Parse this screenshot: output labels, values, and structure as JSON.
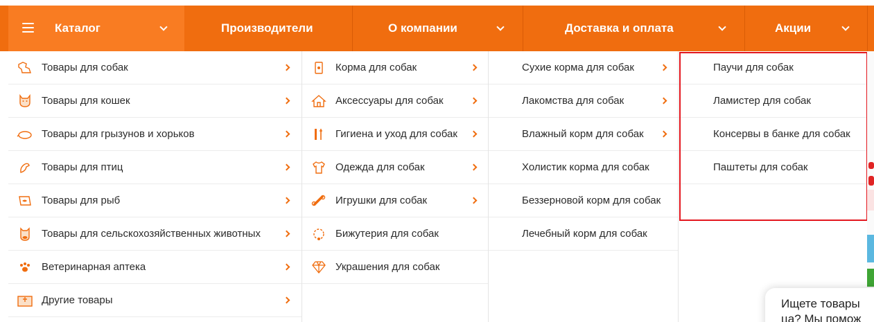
{
  "nav": {
    "catalog": "Каталог",
    "manufacturers": "Производители",
    "about": "О компании",
    "delivery": "Доставка и оплата",
    "sales": "Акции"
  },
  "colors": {
    "accent": "#f06d0f",
    "accent_light": "#f97c22",
    "highlight": "#e3161e"
  },
  "categories": [
    {
      "label": "Товары для собак",
      "icon": "dog-icon"
    },
    {
      "label": "Товары для кошек",
      "icon": "cat-icon"
    },
    {
      "label": "Товары для грызунов и хорьков",
      "icon": "rodent-icon"
    },
    {
      "label": "Товары для птиц",
      "icon": "bird-icon"
    },
    {
      "label": "Товары для рыб",
      "icon": "fish-icon"
    },
    {
      "label": "Товары для сельскохозяйственных животных",
      "icon": "cow-icon"
    },
    {
      "label": "Ветеринарная аптека",
      "icon": "paw-icon"
    },
    {
      "label": "Другие товары",
      "icon": "box-icon"
    }
  ],
  "dog_sub": [
    {
      "label": "Корма для собак",
      "icon": "food-bag-icon",
      "has_children": true
    },
    {
      "label": "Аксессуары для собак",
      "icon": "doghouse-icon",
      "has_children": true
    },
    {
      "label": "Гигиена и уход для собак",
      "icon": "grooming-icon",
      "has_children": true
    },
    {
      "label": "Одежда для собак",
      "icon": "shirt-icon",
      "has_children": true
    },
    {
      "label": "Игрушки для собак",
      "icon": "bone-icon",
      "has_children": true
    },
    {
      "label": "Бижутерия для собак",
      "icon": "necklace-icon",
      "has_children": false
    },
    {
      "label": "Украшения для собак",
      "icon": "diamond-icon",
      "has_children": false
    }
  ],
  "food_sub": [
    {
      "label": "Сухие корма для собак",
      "has_children": true
    },
    {
      "label": "Лакомства для собак",
      "has_children": true
    },
    {
      "label": "Влажный корм для собак",
      "has_children": true
    },
    {
      "label": "Холистик корма для собак",
      "has_children": false
    },
    {
      "label": "Беззерновой корм для собак",
      "has_children": false
    },
    {
      "label": "Лечебный корм для собак",
      "has_children": false
    }
  ],
  "wet_sub": [
    {
      "label": "Паучи для собак"
    },
    {
      "label": "Ламистер для собак"
    },
    {
      "label": "Консервы в банке для собак"
    },
    {
      "label": "Паштеты для собак"
    }
  ],
  "chat": {
    "line1": "Ищете товары",
    "line2": "ца? Мы помож"
  }
}
